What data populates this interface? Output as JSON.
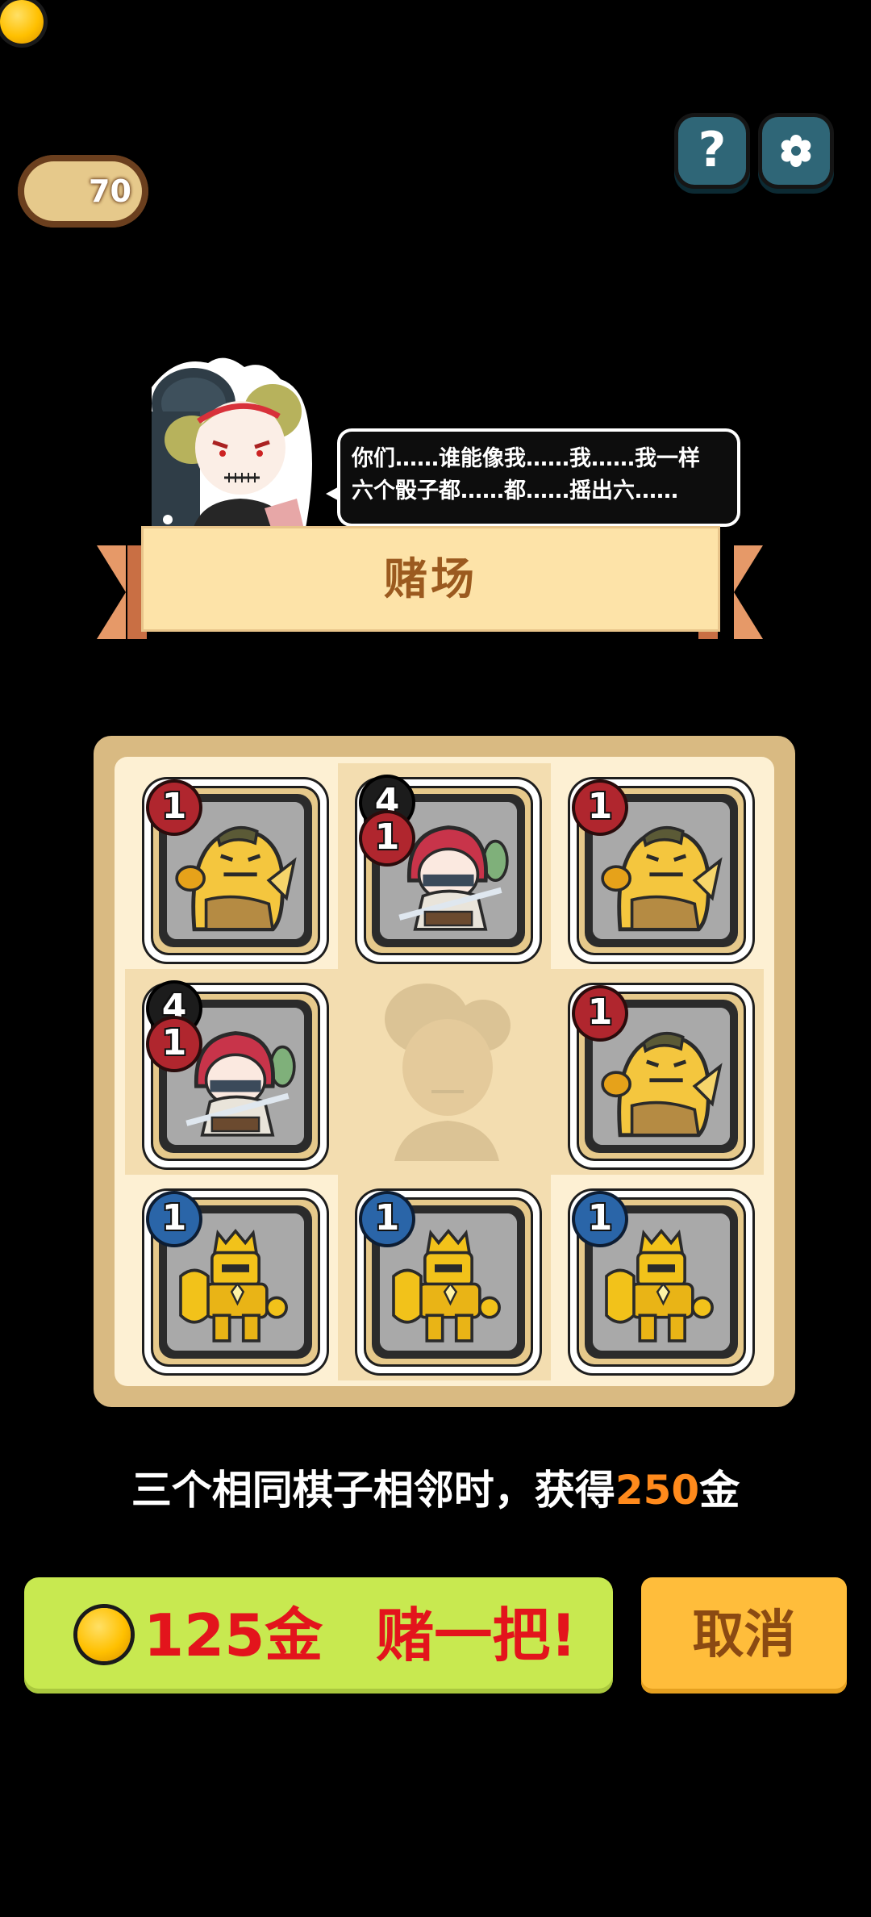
{
  "hud": {
    "coins": "70",
    "coin_icon": "gold-coin-icon",
    "help_label": "?",
    "help_icon": "question-mark-icon",
    "settings_icon": "gear-icon"
  },
  "npc": {
    "portrait_icon": "gambler-girl-portrait",
    "speech_lines": [
      "你们……谁能像我……我……我一样",
      "六个骰子都……都……摇出六……"
    ]
  },
  "banner": {
    "title": "赌场"
  },
  "board": {
    "cells": [
      {
        "unit": "golden-lion-dancer",
        "badges": [
          {
            "value": "1",
            "color": "red"
          }
        ]
      },
      {
        "unit": "red-haired-swordswoman",
        "badges": [
          {
            "value": "4",
            "color": "black"
          },
          {
            "value": "1",
            "color": "red"
          }
        ]
      },
      {
        "unit": "golden-lion-dancer",
        "badges": [
          {
            "value": "1",
            "color": "red"
          }
        ]
      },
      {
        "unit": "red-haired-swordswoman",
        "badges": [
          {
            "value": "4",
            "color": "black"
          },
          {
            "value": "1",
            "color": "red"
          }
        ]
      },
      {
        "unit": "empty-ghost-portrait",
        "badges": []
      },
      {
        "unit": "golden-lion-dancer",
        "badges": [
          {
            "value": "1",
            "color": "red"
          }
        ]
      },
      {
        "unit": "golden-armor-knight",
        "badges": [
          {
            "value": "1",
            "color": "blue"
          }
        ]
      },
      {
        "unit": "golden-armor-knight",
        "badges": [
          {
            "value": "1",
            "color": "blue"
          }
        ]
      },
      {
        "unit": "golden-armor-knight",
        "badges": [
          {
            "value": "1",
            "color": "blue"
          }
        ]
      }
    ]
  },
  "rule": {
    "prefix": "三个相同棋子相邻时，获得",
    "amount": "250",
    "suffix": "金"
  },
  "actions": {
    "bet_cost": "125金",
    "bet_text": "赌一把!",
    "cancel": "取消"
  },
  "colors": {
    "accent_green": "#c8e950",
    "accent_orange": "#ffbd3b",
    "highlight": "#ff8a1c",
    "bet_text": "#e3141c"
  }
}
